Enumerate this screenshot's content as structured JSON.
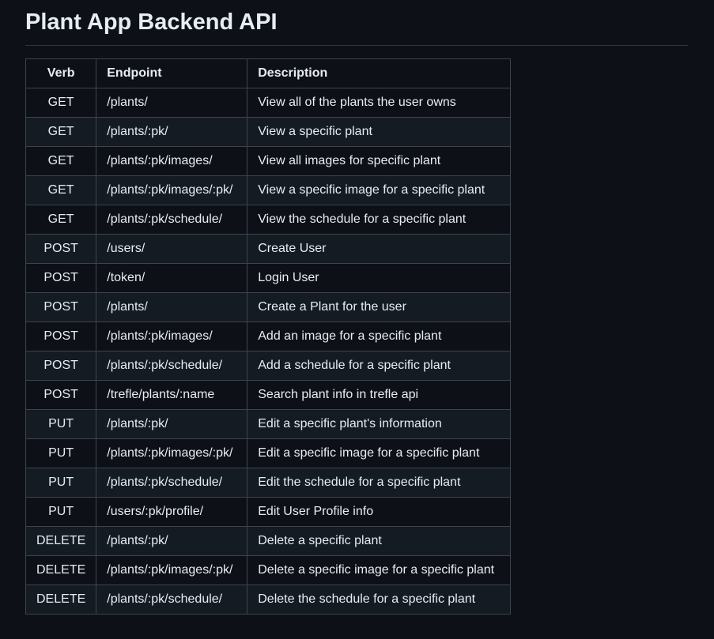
{
  "page": {
    "title": "Plant App Backend API"
  },
  "table": {
    "headers": {
      "verb": "Verb",
      "endpoint": "Endpoint",
      "description": "Description"
    },
    "rows": [
      {
        "verb": "GET",
        "endpoint": "/plants/",
        "description": "View all of the plants the user owns"
      },
      {
        "verb": "GET",
        "endpoint": "/plants/:pk/",
        "description": "View a specific plant"
      },
      {
        "verb": "GET",
        "endpoint": "/plants/:pk/images/",
        "description": "View all images for specific plant"
      },
      {
        "verb": "GET",
        "endpoint": "/plants/:pk/images/:pk/",
        "description": "View a specific image for a specific plant"
      },
      {
        "verb": "GET",
        "endpoint": "/plants/:pk/schedule/",
        "description": "View the schedule for a specific plant"
      },
      {
        "verb": "POST",
        "endpoint": "/users/",
        "description": "Create User"
      },
      {
        "verb": "POST",
        "endpoint": "/token/",
        "description": "Login User"
      },
      {
        "verb": "POST",
        "endpoint": "/plants/",
        "description": "Create a Plant for the user"
      },
      {
        "verb": "POST",
        "endpoint": "/plants/:pk/images/",
        "description": "Add an image for a specific plant"
      },
      {
        "verb": "POST",
        "endpoint": "/plants/:pk/schedule/",
        "description": "Add a schedule for a specific plant"
      },
      {
        "verb": "POST",
        "endpoint": "/trefle/plants/:name",
        "description": "Search plant info in trefle api"
      },
      {
        "verb": "PUT",
        "endpoint": "/plants/:pk/",
        "description": "Edit a specific plant's information"
      },
      {
        "verb": "PUT",
        "endpoint": "/plants/:pk/images/:pk/",
        "description": "Edit a specific image for a specific plant"
      },
      {
        "verb": "PUT",
        "endpoint": "/plants/:pk/schedule/",
        "description": "Edit the schedule for a specific plant"
      },
      {
        "verb": "PUT",
        "endpoint": "/users/:pk/profile/",
        "description": "Edit User Profile info"
      },
      {
        "verb": "DELETE",
        "endpoint": "/plants/:pk/",
        "description": "Delete a specific plant"
      },
      {
        "verb": "DELETE",
        "endpoint": "/plants/:pk/images/:pk/",
        "description": "Delete a specific image for a specific plant"
      },
      {
        "verb": "DELETE",
        "endpoint": "/plants/:pk/schedule/",
        "description": "Delete the schedule for a specific plant"
      }
    ]
  },
  "colors": {
    "background": "#0d1117",
    "row_alt": "#151b23",
    "border": "#3d444d",
    "text": "#e6edf3"
  }
}
